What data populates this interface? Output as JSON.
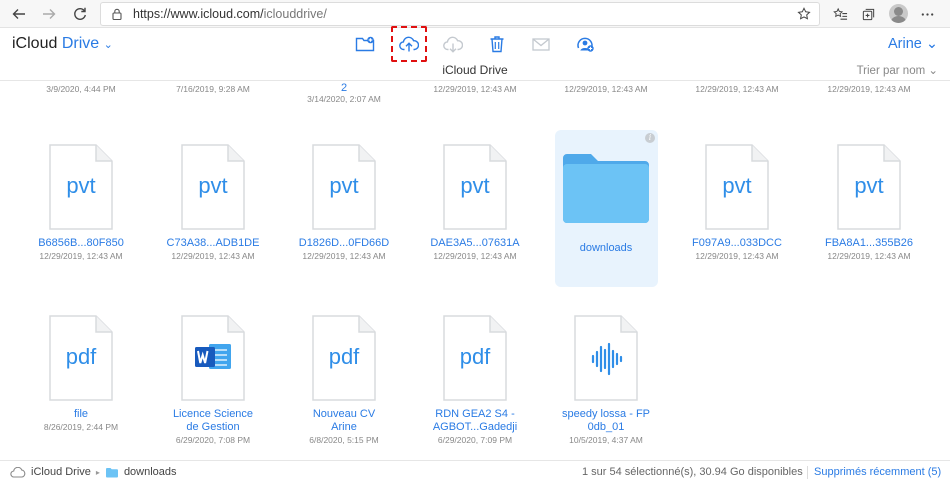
{
  "browser": {
    "url_host": "https://www.icloud.com/",
    "url_path": "iclouddrive/",
    "icons": [
      "back-arrow-icon",
      "forward-arrow-icon",
      "refresh-icon",
      "lock-icon",
      "star-icon",
      "favorites-icon",
      "collections-icon",
      "profile-avatar"
    ]
  },
  "header": {
    "app_name": "iCloud",
    "app_drive": "Drive",
    "chevron": "⌄",
    "user": "Arine ⌄",
    "tools": [
      "new-folder-icon",
      "upload-icon",
      "download-icon",
      "delete-icon",
      "mail-icon",
      "share-icon"
    ]
  },
  "subheader": {
    "title": "iCloud Drive",
    "sort": "Trier par nom ⌄"
  },
  "top_row": [
    {
      "name": "",
      "date": "3/9/2020, 4:44 PM"
    },
    {
      "name": "",
      "date": "7/16/2019, 9:28 AM"
    },
    {
      "name": "2",
      "date": "3/14/2020, 2:07 AM"
    },
    {
      "name": "",
      "date": "12/29/2019, 12:43 AM"
    },
    {
      "name": "",
      "date": "12/29/2019, 12:43 AM"
    },
    {
      "name": "",
      "date": "12/29/2019, 12:43 AM"
    },
    {
      "name": "",
      "date": "12/29/2019, 12:43 AM"
    }
  ],
  "row1": [
    {
      "ext": "pvt",
      "name": "B6856B...80F850",
      "date": "12/29/2019, 12:43 AM"
    },
    {
      "ext": "pvt",
      "name": "C73A38...ADB1DE",
      "date": "12/29/2019, 12:43 AM"
    },
    {
      "ext": "pvt",
      "name": "D1826D...0FD66D",
      "date": "12/29/2019, 12:43 AM"
    },
    {
      "ext": "pvt",
      "name": "DAE3A5...07631A",
      "date": "12/29/2019, 12:43 AM"
    },
    {
      "ext": "",
      "name": "downloads",
      "date": ""
    },
    {
      "ext": "pvt",
      "name": "F097A9...033DCC",
      "date": "12/29/2019, 12:43 AM"
    },
    {
      "ext": "pvt",
      "name": "FBA8A1...355B26",
      "date": "12/29/2019, 12:43 AM"
    }
  ],
  "row2": [
    {
      "ext": "pdf",
      "name": "file",
      "name2": "",
      "date": "8/26/2019, 2:44 PM"
    },
    {
      "ext": "word",
      "name": "Licence Science",
      "name2": "de Gestion",
      "date": "6/29/2020, 7:08 PM"
    },
    {
      "ext": "pdf",
      "name": "Nouveau CV",
      "name2": "Arine",
      "date": "6/8/2020, 5:15 PM"
    },
    {
      "ext": "pdf",
      "name": "RDN GEA2 S4 -",
      "name2": "AGBOT...Gadedji",
      "date": "6/29/2020, 7:09 PM"
    },
    {
      "ext": "audio",
      "name": "speedy lossa - FP",
      "name2": "0db_01",
      "date": "10/5/2019, 4:37 AM"
    }
  ],
  "footer": {
    "crumb_root": "iCloud Drive",
    "crumb_current": "downloads",
    "status": "1 sur 54 sélectionné(s), 30.94 Go disponibles",
    "deleted": "Supprimés récemment (5)"
  },
  "colors": {
    "accent": "#2a7be4",
    "selection": "#e8f3fd",
    "folder": "#5bb6f2",
    "highlight": "#e01010"
  }
}
